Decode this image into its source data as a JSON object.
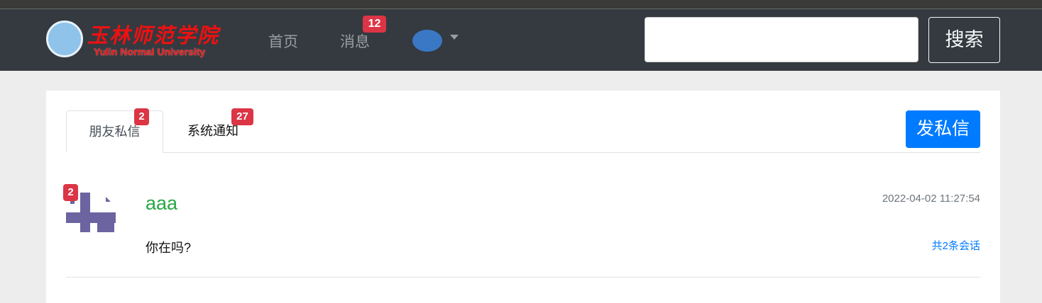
{
  "header": {
    "logo": {
      "cn": "玉林师范学院",
      "en": "Yulin Normal University"
    },
    "nav": [
      {
        "label": "首页"
      },
      {
        "label": "消息",
        "badge": "12"
      }
    ],
    "search": {
      "value": "",
      "placeholder": ""
    },
    "search_button": "搜索"
  },
  "tabs": [
    {
      "label": "朋友私信",
      "badge": "2",
      "active": true
    },
    {
      "label": "系统通知",
      "badge": "27",
      "active": false
    }
  ],
  "send_button": "发私信",
  "messages": [
    {
      "name": "aaa",
      "badge": "2",
      "text": "你在吗?",
      "time": "2022-04-02 11:27:54",
      "conversation_count": "共2条会话"
    }
  ],
  "colors": {
    "nav_bg": "#343a40",
    "badge": "#dc3545",
    "primary": "#007bff",
    "username": "#28a745",
    "avatar": "#6c64a0"
  }
}
